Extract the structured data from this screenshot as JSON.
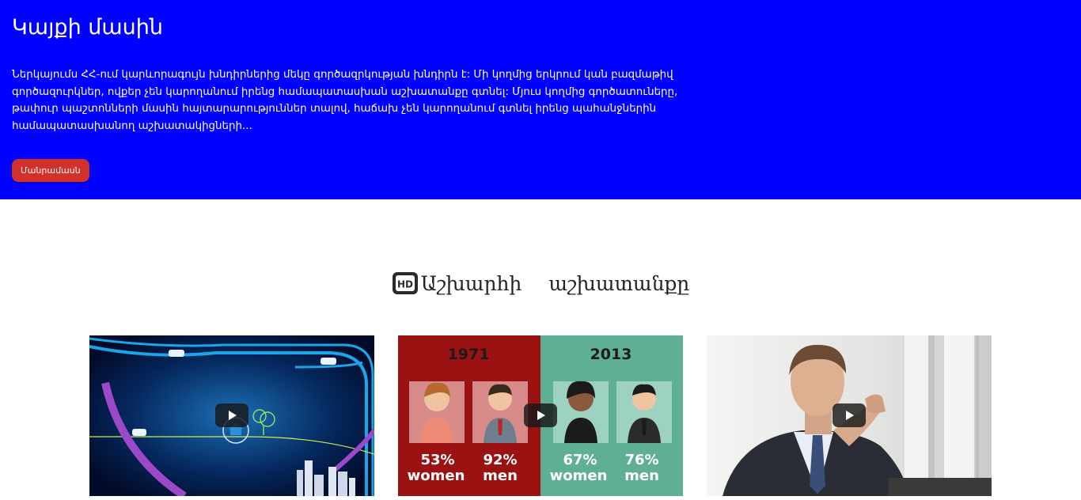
{
  "hero": {
    "title": "Կայքի մասին",
    "description": "Ներկայումս ՀՀ-ում կարևորագույն խնդիրներից մեկը գործազրկության խնդիրն է: Մի կողմից երկրում կան բազմաթիվ գործազուրկներ, ովքեր չեն կարողանում իրենց համապատասխան աշխատանքը գտնել: Մյուս կողմից գործատուները, թափուր պաշտոնների մասին հայտարարություններ տալով, հաճախ չեն կարողանում գտնել իրենց պահանջներին համապատասխանող աշխատակիցների...",
    "button_label": "Մանրամասն",
    "background_color": "#0000ff",
    "button_color": "#d2312a"
  },
  "videos_section": {
    "icon": "hd-icon",
    "title_word1": "Աշխարհի",
    "title_word2": "աշխատանքը"
  },
  "videos": [
    {
      "thumbnail": "animated city map with roads and cars",
      "play_icon": "play-icon"
    },
    {
      "thumbnail": "infographic women and men comparison",
      "play_icon": "play-icon",
      "left": {
        "year": "1971",
        "women_pct": "53%",
        "women_label": "women",
        "men_pct": "92%",
        "men_label": "men",
        "color": "#9a1212"
      },
      "right": {
        "year": "2013",
        "women_pct": "67%",
        "women_label": "women",
        "men_pct": "76%",
        "men_label": "men",
        "color": "#5fae96"
      }
    },
    {
      "thumbnail": "businessman in suit thinking",
      "play_icon": "play-icon"
    }
  ]
}
